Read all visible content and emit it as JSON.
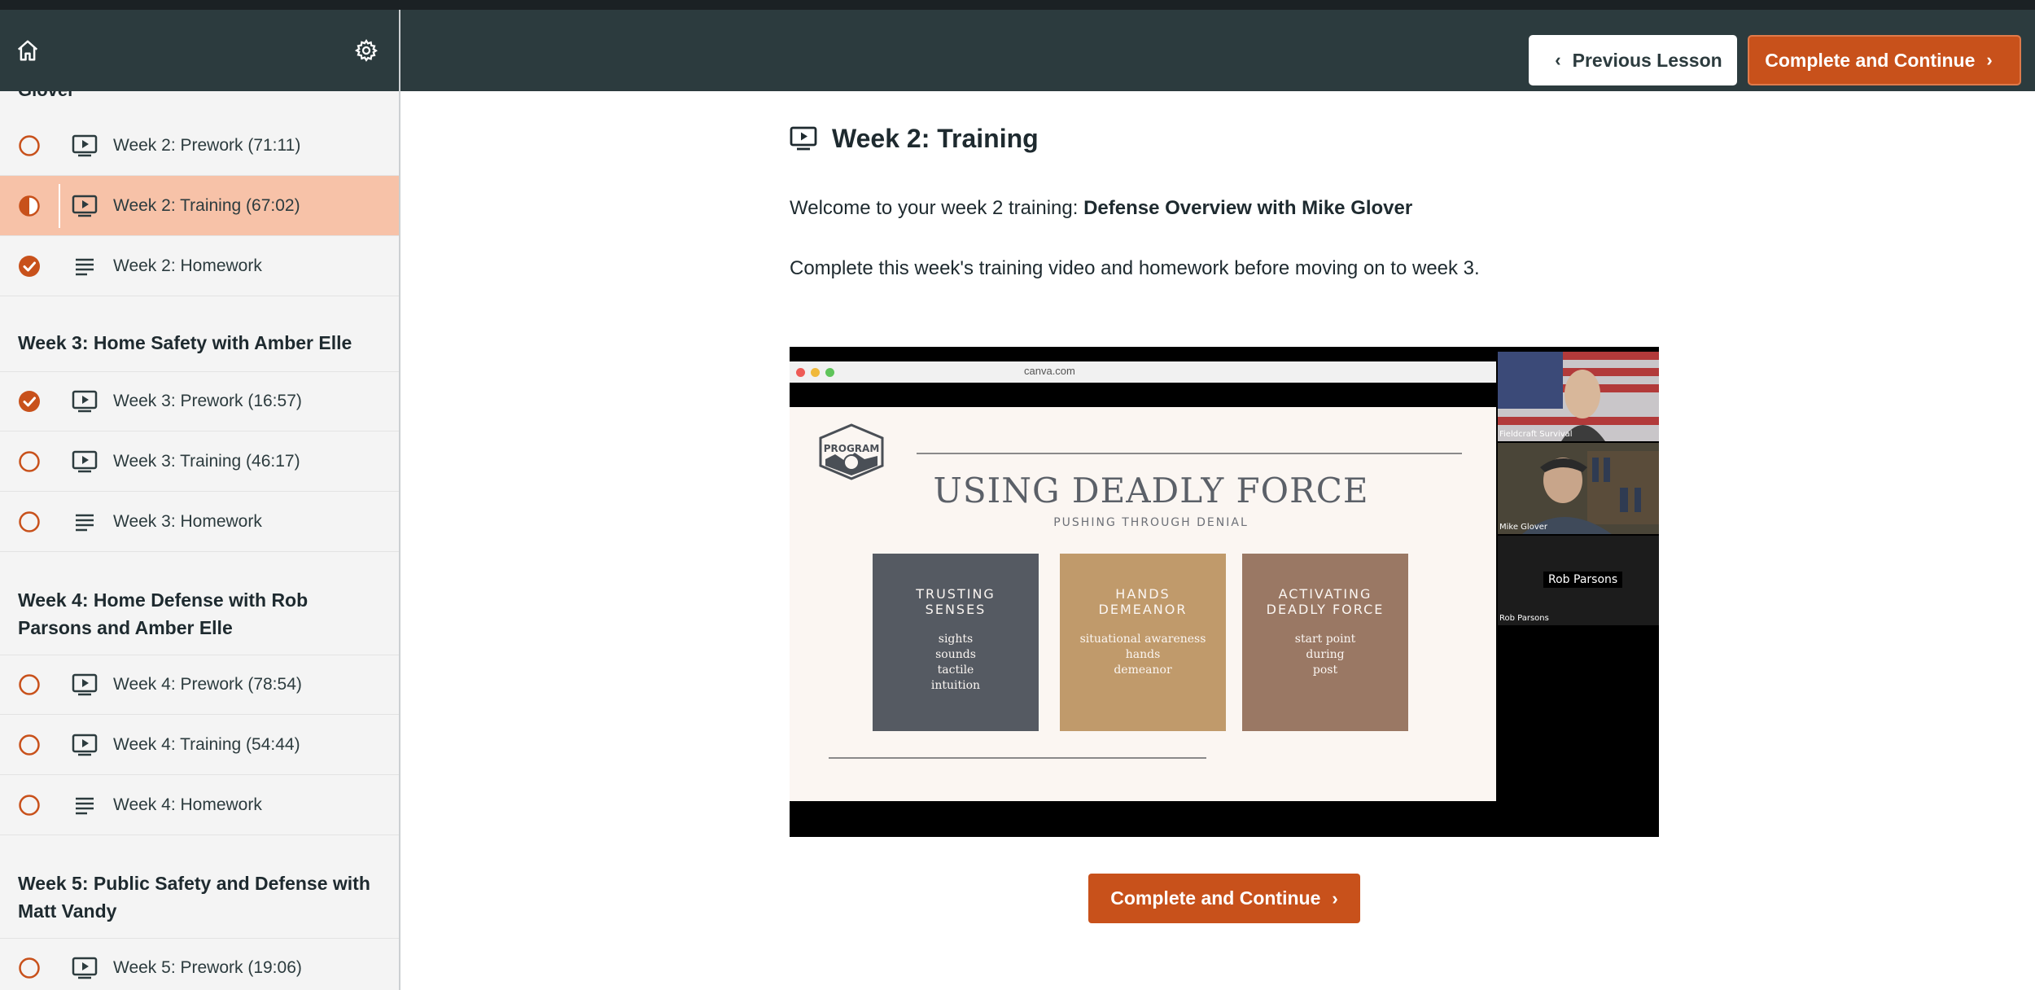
{
  "header": {
    "home_icon": "home-icon",
    "settings_icon": "gear-icon",
    "prev_label": "Previous Lesson",
    "next_label": "Complete and Continue"
  },
  "sidebar": {
    "cut_section_fragment": "Glover",
    "lessons_top": [
      {
        "title": "Week 2: Prework (71:11)",
        "type": "video",
        "status": "incomplete"
      },
      {
        "title": "Week 2: Training (67:02)",
        "type": "video",
        "status": "in-progress",
        "active": true
      },
      {
        "title": "Week 2: Homework",
        "type": "text",
        "status": "complete"
      }
    ],
    "sections": [
      {
        "title": "Week 3: Home Safety with Amber Elle",
        "lessons": [
          {
            "title": "Week 3: Prework (16:57)",
            "type": "video",
            "status": "complete"
          },
          {
            "title": "Week 3: Training (46:17)",
            "type": "video",
            "status": "incomplete"
          },
          {
            "title": "Week 3: Homework",
            "type": "text",
            "status": "incomplete"
          }
        ]
      },
      {
        "title": "Week 4: Home Defense with Rob Parsons and Amber Elle",
        "lessons": [
          {
            "title": "Week 4: Prework (78:54)",
            "type": "video",
            "status": "incomplete"
          },
          {
            "title": "Week 4: Training (54:44)",
            "type": "video",
            "status": "incomplete"
          },
          {
            "title": "Week 4: Homework",
            "type": "text",
            "status": "incomplete"
          }
        ]
      },
      {
        "title": "Week 5: Public Safety and Defense with Matt Vandy",
        "lessons": [
          {
            "title": "Week 5: Prework (19:06)",
            "type": "video",
            "status": "incomplete"
          }
        ]
      }
    ]
  },
  "main": {
    "title": "Week 2: Training",
    "intro_prefix": "Welcome to your week 2 training: ",
    "intro_bold": "Defense Overview with Mike Glover",
    "instructions": "Complete this week's training video and homework before moving on to week 3.",
    "cta_label": "Complete and Continue"
  },
  "video": {
    "browser_url": "canva.com",
    "logo_text": "PROGRAM",
    "slide_title": "USING DEADLY FORCE",
    "slide_subtitle": "PUSHING THROUGH DENIAL",
    "boxes": [
      {
        "heading": "TRUSTING SENSES",
        "body": [
          "sights",
          "sounds",
          "tactile",
          "intuition"
        ],
        "color": "#555a62"
      },
      {
        "heading": "HANDS DEMEANOR",
        "body": [
          "situational awareness",
          "hands",
          "demeanor"
        ],
        "color": "#c09a6b"
      },
      {
        "heading": "ACTIVATING DEADLY FORCE",
        "body": [
          "start point",
          "during",
          "post"
        ],
        "color": "#9a7864"
      }
    ],
    "participants": [
      {
        "label": "Fieldcraft Survival"
      },
      {
        "label": "Mike Glover"
      },
      {
        "label": "Rob Parsons",
        "name_tag": "Rob Parsons"
      }
    ]
  },
  "colors": {
    "accent": "#c8511b",
    "header_bg": "#2c3b3e",
    "active_lesson_bg": "#f7c2a8"
  }
}
